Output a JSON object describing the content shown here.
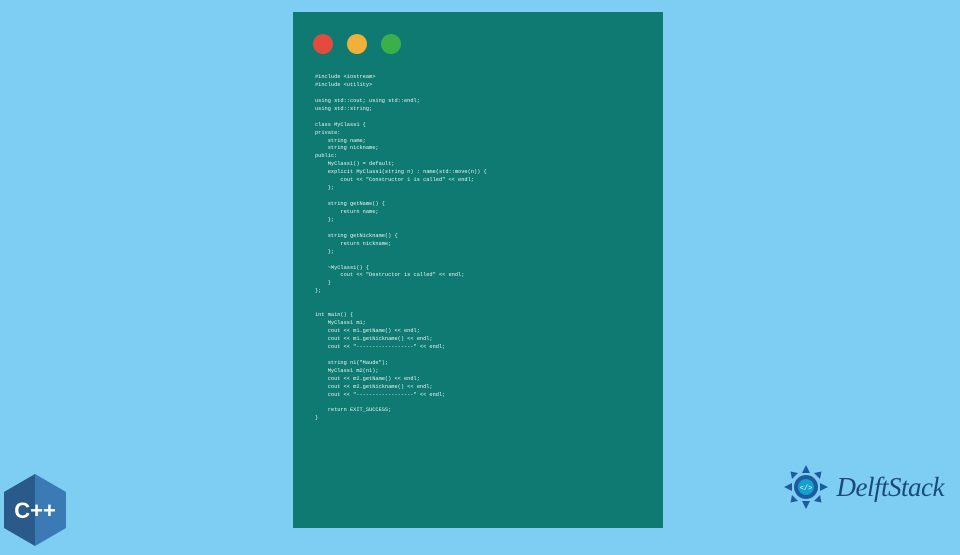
{
  "window": {
    "buttons": [
      "close",
      "minimize",
      "zoom"
    ]
  },
  "code": "#include <iostream>\n#include <utility>\n\nusing std::cout; using std::endl;\nusing std::string;\n\nclass MyClass1 {\nprivate:\n    string name;\n    string nickname;\npublic:\n    MyClass1() = default;\n    explicit MyClass1(string n) : name(std::move(n)) {\n        cout << \"Constructor 1 is called\" << endl;\n    };\n\n    string getName() {\n        return name;\n    };\n\n    string getNickname() {\n        return nickname;\n    };\n\n    ~MyClass1() {\n        cout << \"Destructor is called\" << endl;\n    }\n};\n\n\nint main() {\n    MyClass1 m1;\n    cout << m1.getName() << endl;\n    cout << m1.getNickname() << endl;\n    cout << \"------------------\" << endl;\n\n    string n1(\"Maude\");\n    MyClass1 m2(n1);\n    cout << m2.getName() << endl;\n    cout << m2.getNickname() << endl;\n    cout << \"------------------\" << endl;\n\n    return EXIT_SUCCESS;\n}",
  "cpp_logo": {
    "label": "C++"
  },
  "delftstack": {
    "label": "DelftStack"
  }
}
